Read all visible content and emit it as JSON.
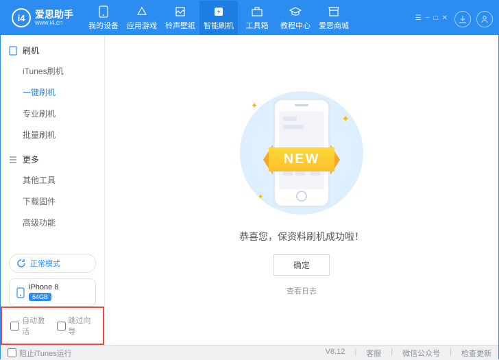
{
  "app": {
    "name": "爱思助手",
    "url": "www.i4.cn",
    "logo_text": "i4"
  },
  "win_controls": [
    "☰",
    "−",
    "□",
    "✕"
  ],
  "top_nav": [
    {
      "label": "我的设备"
    },
    {
      "label": "应用游戏"
    },
    {
      "label": "铃声壁纸"
    },
    {
      "label": "智能刷机",
      "active": true
    },
    {
      "label": "工具箱"
    },
    {
      "label": "教程中心"
    },
    {
      "label": "爱思商城"
    }
  ],
  "sidebar": {
    "groups": [
      {
        "title": "刷机",
        "items": [
          {
            "label": "iTunes刷机"
          },
          {
            "label": "一键刷机",
            "active": true
          },
          {
            "label": "专业刷机"
          },
          {
            "label": "批量刷机"
          }
        ]
      },
      {
        "title": "更多",
        "items": [
          {
            "label": "其他工具"
          },
          {
            "label": "下载固件"
          },
          {
            "label": "高级功能"
          }
        ]
      }
    ],
    "mode": "正常模式",
    "device_name": "iPhone 8",
    "device_storage": "64GB",
    "checks": [
      {
        "label": "自动激活"
      },
      {
        "label": "跳过向导"
      }
    ]
  },
  "main": {
    "ribbon": "NEW",
    "message": "恭喜您，保资料刷机成功啦！",
    "confirm": "确定",
    "log_link": "查看日志"
  },
  "status": {
    "block_itunes": "阻止iTunes运行",
    "version": "V8.12",
    "items": [
      "客服",
      "微信公众号",
      "检查更新"
    ]
  }
}
